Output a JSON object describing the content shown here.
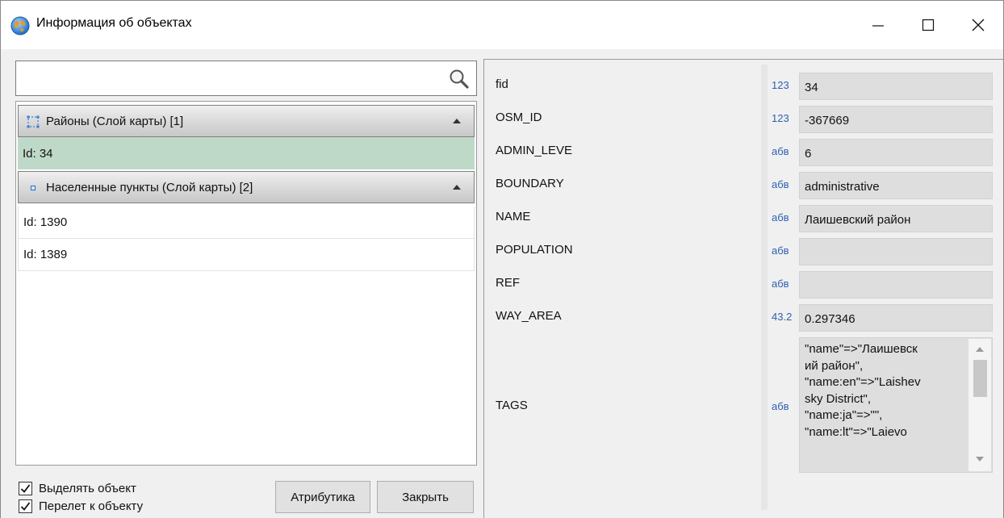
{
  "window": {
    "title": "Информация об объектах",
    "icon": "globe-icon"
  },
  "search": {
    "value": "",
    "placeholder": ""
  },
  "tree": {
    "groups": [
      {
        "label": "Районы (Слой карты) [1]",
        "icon": "polygon-layer-icon",
        "items": [
          {
            "label": "Id: 34",
            "selected": true
          }
        ]
      },
      {
        "label": "Населенные пункты (Слой карты) [2]",
        "icon": "point-layer-icon",
        "items": [
          {
            "label": "Id: 1390",
            "selected": false
          },
          {
            "label": "Id: 1389",
            "selected": false
          }
        ]
      }
    ]
  },
  "options": {
    "highlight_label": "Выделять объект",
    "highlight_checked": true,
    "fly_label": "Перелет к объекту",
    "fly_checked": true
  },
  "buttons": {
    "attributes_label": "Атрибутика",
    "close_label": "Закрыть"
  },
  "properties": [
    {
      "name": "fid",
      "type": "123",
      "value": "34"
    },
    {
      "name": "OSM_ID",
      "type": "123",
      "value": "-367669"
    },
    {
      "name": "ADMIN_LEVE",
      "type": "абв",
      "value": "6"
    },
    {
      "name": "BOUNDARY",
      "type": "абв",
      "value": "administrative"
    },
    {
      "name": "NAME",
      "type": "абв",
      "value": "Лаишевский район"
    },
    {
      "name": "POPULATION",
      "type": "абв",
      "value": ""
    },
    {
      "name": "REF",
      "type": "абв",
      "value": ""
    },
    {
      "name": "WAY_AREA",
      "type": "43.2",
      "value": "0.297346"
    }
  ],
  "tags": {
    "name": "TAGS",
    "type": "абв",
    "value": "\"name\"=>\"Лаишевск\nий район\",\n\"name:en\"=>\"Laishev\nsky District\",\n\"name:ja\"=>\"\",\n\"name:lt\"=>\"Laievo"
  },
  "colors": {
    "selected_row": "#bfd9c9",
    "type_label": "#2f5fb0"
  }
}
